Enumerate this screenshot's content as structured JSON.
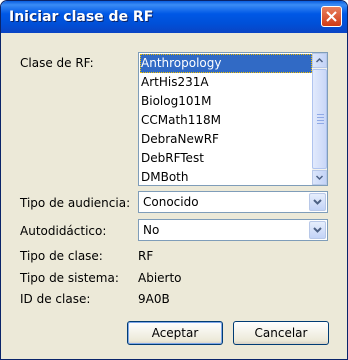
{
  "window": {
    "title": "Iniciar clase de RF"
  },
  "form": {
    "clase_rf_label": "Clase de RF:",
    "clase_rf_options": [
      "Anthropology",
      "ArtHis231A",
      "Biolog101M",
      "CCMath118M",
      "DebraNewRF",
      "DebRFTest",
      "DMBoth"
    ],
    "clase_rf_selected": "Anthropology",
    "audiencia_label": "Tipo de audiencia:",
    "audiencia_value": "Conocido",
    "autodidactico_label": "Autodidáctico:",
    "autodidactico_value": "No",
    "tipo_clase_label": "Tipo de clase:",
    "tipo_clase_value": "RF",
    "tipo_sistema_label": "Tipo de sistema:",
    "tipo_sistema_value": "Abierto",
    "id_clase_label": "ID de clase:",
    "id_clase_value": "9A0B"
  },
  "buttons": {
    "accept": "Aceptar",
    "cancel": "Cancelar"
  },
  "colors": {
    "titlebar": "#0058e6",
    "dialog_bg": "#ece9d8",
    "selection": "#316ac5",
    "close_button": "#d03a14"
  },
  "icons": [
    "close-icon",
    "scroll-up-icon",
    "scroll-down-icon",
    "dropdown-arrow-icon"
  ]
}
